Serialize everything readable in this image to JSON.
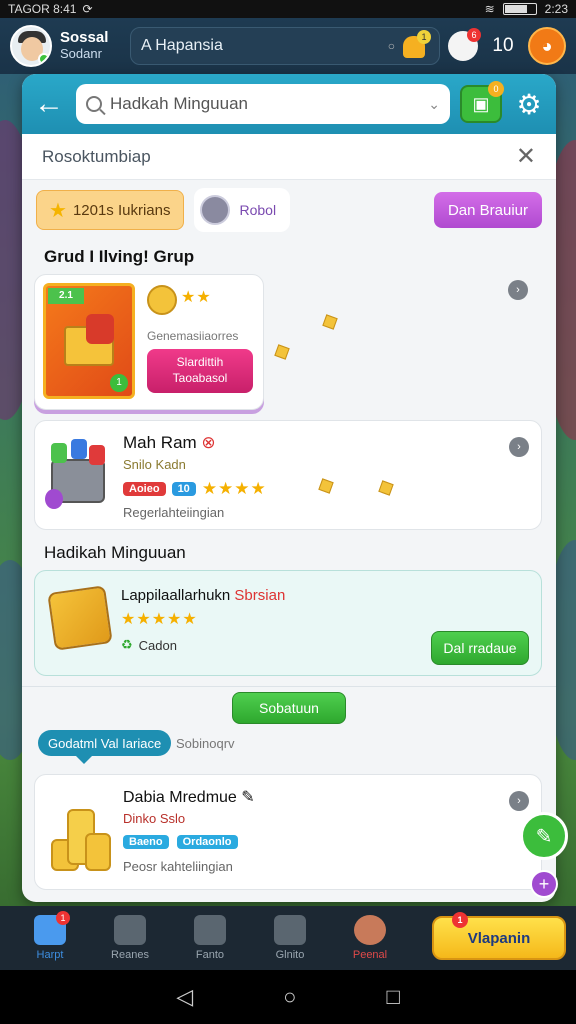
{
  "status_bar": {
    "left_text": "TAGOR 8:41",
    "right_text": "2:23"
  },
  "top_bar": {
    "profile_name": "Sossal",
    "profile_sub": "Sodanr",
    "search_text": "A Hapansia",
    "bell_badge": "1",
    "notif_badge": "6",
    "count": "10"
  },
  "panel": {
    "search_placeholder": "Hadkah Minguuan",
    "box_badge": "0",
    "subhead_title": "Rosoktumbiap",
    "chip_star_label": "1201s Iukrians",
    "chip_robot_label": "Robol",
    "pink_button_label": "Dan Brauiur"
  },
  "section1": {
    "title": "Grud I Ilving! Grup",
    "card1": {
      "gift_ribbon": "2.1",
      "corner_badge": "1",
      "subtitle": "Genemasiiaorres",
      "button_line1": "Slardittih",
      "button_line2": "Taoabasol"
    },
    "card2": {
      "title": "Mah Ram",
      "subtitle": "Snilo Kadn",
      "tag_red": "Aoieo",
      "tag_blue": "10",
      "footer": "Regerlahteiingian"
    }
  },
  "section2": {
    "title": "Hadikah Minguuan",
    "card3": {
      "title_black": "Lappilaallarhukn",
      "title_red": "Sbrsian",
      "meta": "Cadon",
      "button_label": "Dal rradaue"
    },
    "center_button_label": "Sobatuun",
    "tooltip_label": "Godatml Val Iariace",
    "tooltip_side": "Sobinoqrv",
    "card4": {
      "title": "Dabia Mredmue",
      "subtitle": "Dinko Sslo",
      "tag_blue": "Baeno",
      "tag_blue2": "Ordaonlo",
      "footer": "Peosr kahteliingian"
    }
  },
  "bottom_nav": {
    "items": [
      {
        "label": "Harpt",
        "badge": "1"
      },
      {
        "label": "Reanes"
      },
      {
        "label": "Fanto"
      },
      {
        "label": "Glnito"
      },
      {
        "label": "Peenal"
      }
    ],
    "cta_label": "Vlapanin",
    "cta_badge": "1"
  },
  "colors": {
    "accent_teal": "#1e8fb2",
    "accent_green": "#3cbd3c",
    "accent_pink": "#b04ad0",
    "accent_yellow": "#f5b81a"
  },
  "icons": {
    "back": "arrow-left-icon",
    "search": "search-icon",
    "settings": "gear-icon",
    "close": "close-icon",
    "more": "more-icon"
  }
}
